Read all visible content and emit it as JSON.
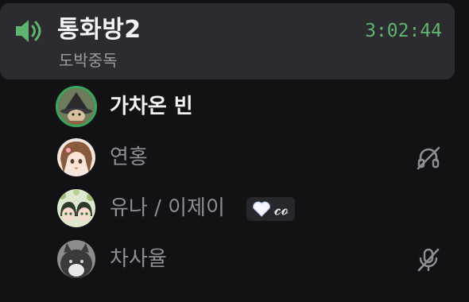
{
  "channel": {
    "name": "통화방2",
    "status": "도박중독",
    "elapsed": "3:02:44",
    "icon": "speaker-icon",
    "accent_color": "#5fb56f"
  },
  "participants": [
    {
      "name": "가차온 빈",
      "speaking": true,
      "avatar": "avatar-witch-hat",
      "state_icon": null
    },
    {
      "name": "연홍",
      "speaking": false,
      "avatar": "avatar-anime-girl",
      "state_icon": "deafened-icon"
    },
    {
      "name": "유나 / 이제이",
      "speaking": false,
      "avatar": "avatar-pair-green",
      "badge": {
        "icon": "white-heart-icon",
        "text": "𝓬𝓸"
      },
      "state_icon": null
    },
    {
      "name": "차사율",
      "speaking": false,
      "avatar": "avatar-cat",
      "state_icon": "muted-mic-icon"
    }
  ],
  "colors": {
    "speaking_ring": "#3ba55c",
    "background": "#121214",
    "header_background": "#2b2b30"
  }
}
